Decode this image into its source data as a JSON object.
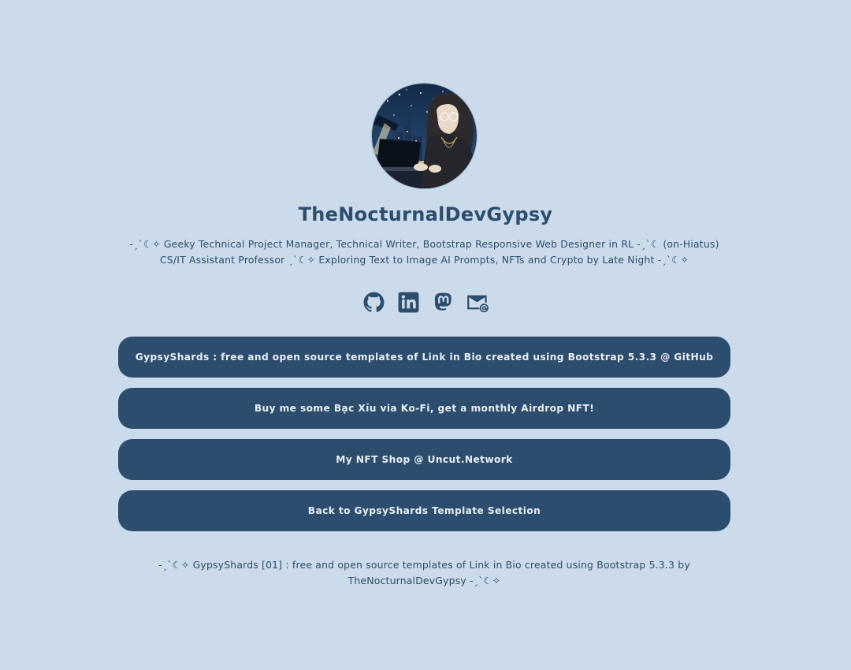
{
  "profile": {
    "avatar_alt": "TheNocturnalDevGypsy",
    "name": "TheNocturnalDevGypsy",
    "bio": "-ˏˋ☾✧ Geeky Technical Project Manager, Technical Writer, Bootstrap Responsive Web Designer in RL -ˏˋ☾ (on-Hiatus) CS/IT Assistant Professor ˏˋ☾✧ Exploring Text to Image AI Prompts, NFTs and Crypto by Late Night -ˏˋ☾✧"
  },
  "socials": [
    {
      "icon": "github-icon"
    },
    {
      "icon": "linkedin-icon"
    },
    {
      "icon": "mastodon-icon"
    },
    {
      "icon": "email-icon"
    }
  ],
  "links": [
    {
      "label": "GypsyShards : free and open source templates of Link in Bio created using Bootstrap 5.3.3 @ GitHub"
    },
    {
      "label": "Buy me some Bạc Xỉu via Ko-Fi, get a monthly Airdrop NFT!"
    },
    {
      "label": "My NFT Shop @ Uncut.Network"
    },
    {
      "label": "Back to GypsyShards Template Selection"
    }
  ],
  "footer": {
    "text": "-ˏˋ☾✧ GypsyShards [01] : free and open source templates of Link in Bio created using Bootstrap 5.3.3 by TheNocturnalDevGypsy -ˏˋ☾✧"
  },
  "colors": {
    "background": "#cbdbeb",
    "accent": "#2c4d6e",
    "button_text": "#e8eef5"
  }
}
